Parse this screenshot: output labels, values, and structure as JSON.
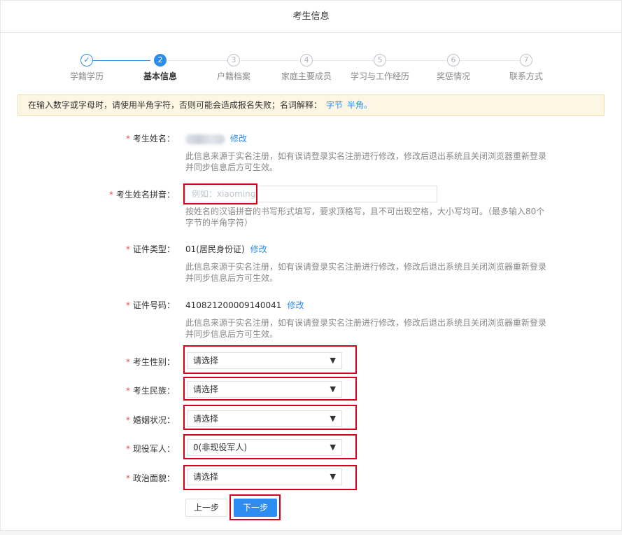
{
  "header": {
    "title": "考生信息"
  },
  "steps": [
    {
      "num": "✓",
      "label": "学籍学历",
      "state": "done"
    },
    {
      "num": "2",
      "label": "基本信息",
      "state": "active"
    },
    {
      "num": "3",
      "label": "户籍档案",
      "state": "todo"
    },
    {
      "num": "4",
      "label": "家庭主要成员",
      "state": "todo"
    },
    {
      "num": "5",
      "label": "学习与工作经历",
      "state": "todo"
    },
    {
      "num": "6",
      "label": "奖惩情况",
      "state": "todo"
    },
    {
      "num": "7",
      "label": "联系方式",
      "state": "todo"
    }
  ],
  "notice": {
    "text": "在输入数字或字母时，请使用半角字符，否则可能会造成报名失败；名词解释：",
    "link1": "字节",
    "link2": "半角。"
  },
  "form": {
    "name": {
      "label": "考生姓名：",
      "edit": "修改",
      "hint": "此信息来源于实名注册，如有误请登录实名注册进行修改，修改后退出系统且关闭浏览器重新登录并同步信息后方可生效。"
    },
    "pinyin": {
      "label": "考生姓名拼音：",
      "placeholder": "例如：xiaoming",
      "hint": "按姓名的汉语拼音的书写形式填写，要求顶格写，且不可出现空格，大小写均可。（最多输入80个字节的半角字符）"
    },
    "idtype": {
      "label": "证件类型：",
      "value": "01(居民身份证)",
      "edit": "修改",
      "hint": "此信息来源于实名注册，如有误请登录实名注册进行修改，修改后退出系统且关闭浏览器重新登录并同步信息后方可生效。"
    },
    "idnum": {
      "label": "证件号码：",
      "value": "410821200009140041",
      "edit": "修改",
      "hint": "此信息来源于实名注册，如有误请登录实名注册进行修改，修改后退出系统且关闭浏览器重新登录并同步信息后方可生效。"
    },
    "gender": {
      "label": "考生性别：",
      "value": "请选择"
    },
    "ethnic": {
      "label": "考生民族：",
      "value": "请选择"
    },
    "marital": {
      "label": "婚姻状况：",
      "value": "请选择"
    },
    "military": {
      "label": "现役军人：",
      "value": "0(非现役军人)"
    },
    "political": {
      "label": "政治面貌：",
      "value": "请选择"
    }
  },
  "buttons": {
    "prev": "上一步",
    "next": "下一步"
  },
  "colors": {
    "accent": "#2d8cf0",
    "required": "#d9534f",
    "highlight_box": "#d9001b",
    "notice_bg": "#fdf6e3"
  },
  "icons": {
    "step_done": "check-icon",
    "select_arrow": "triangle-down-icon"
  }
}
